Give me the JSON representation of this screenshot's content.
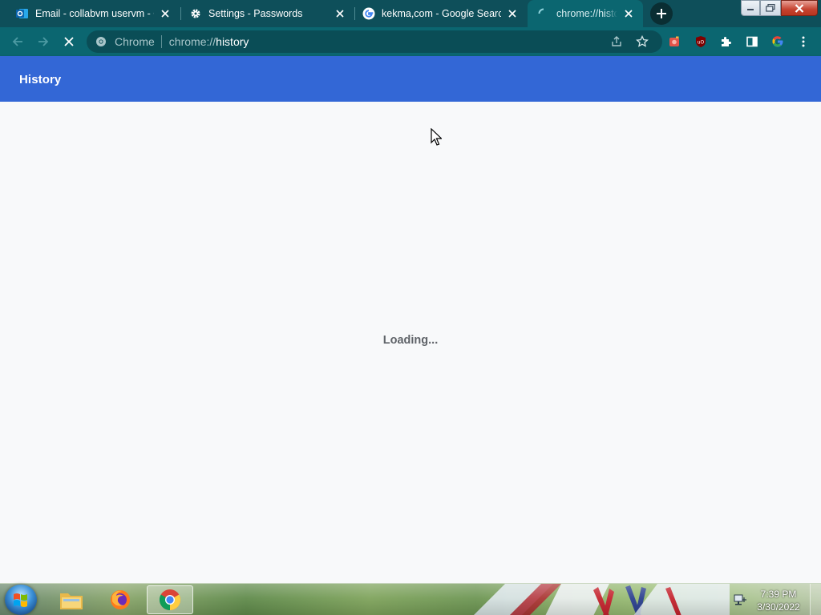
{
  "tabs": [
    {
      "title": "Email - collabvm uservm - O",
      "icon": "outlook-icon",
      "active": false
    },
    {
      "title": "Settings - Passwords",
      "icon": "gear-icon",
      "active": false
    },
    {
      "title": "kekma,com - Google Search",
      "icon": "google-icon",
      "active": false
    },
    {
      "title": "chrome://history",
      "icon": "loading-spinner-icon",
      "active": true
    }
  ],
  "omnibox": {
    "chip_label": "Chrome",
    "url_prefix": "chrome://",
    "url_host": "history"
  },
  "page": {
    "title": "History",
    "loading_text": "Loading..."
  },
  "taskbar": {
    "clock_time": "7:39 PM",
    "clock_date": "3/30/2022"
  },
  "colors": {
    "tabstrip": "#0e4f5a",
    "toolbar": "#0b6670",
    "header": "#3367d6",
    "content_bg": "#f8f9fa"
  }
}
